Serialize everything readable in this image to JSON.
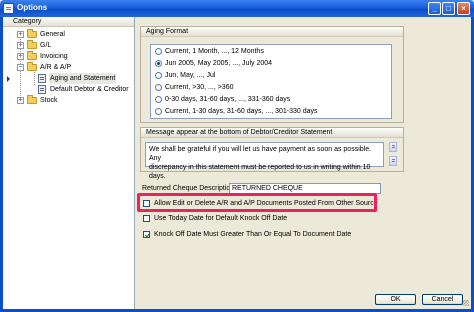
{
  "window": {
    "title": "Options"
  },
  "sidebar": {
    "header": "Category",
    "items": [
      {
        "label": "General",
        "expander": "+"
      },
      {
        "label": "G/L",
        "expander": "+"
      },
      {
        "label": "Invoicing",
        "expander": "+"
      },
      {
        "label": "A/R & A/P",
        "expander": "−"
      },
      {
        "label": "Aging and Statement"
      },
      {
        "label": "Default Debtor & Creditor"
      },
      {
        "label": "Stock",
        "expander": "+"
      }
    ]
  },
  "aging": {
    "title": "Aging Format",
    "options": [
      "Current, 1 Month, ..., 12 Months",
      "Jun 2005, May 2005, ..., July 2004",
      "Jun, May, ..., Jul",
      "Current, >30, ..., >360",
      "0-30 days, 31-60 days, ..., 331-360 days",
      "Current, 1-30 days, 31-60 days, ..., 301-330 days"
    ],
    "selected_index": 1
  },
  "statement": {
    "title": "Message appear at the bottom of Debtor/Creditor Statement",
    "message_line1": "We shall be grateful if you will let us have payment as soon as possible.  Any",
    "message_line2": "discrepancy in this statement must be reported to us in writing within 10 days."
  },
  "returned_cheque": {
    "label": "Returned Cheque Description:",
    "value": "RETURNED CHEQUE"
  },
  "checkboxes": [
    {
      "label": "Allow Edit or Delete A/R and A/P Documents Posted From Other Source",
      "checked": false
    },
    {
      "label": "Use Today Date for Default Knock Off Date",
      "checked": false
    },
    {
      "label": "Knock Off Date Must Greater Than Or Equal To Document Date",
      "checked": true
    }
  ],
  "buttons": {
    "ok": "OK",
    "cancel": "Cancel"
  },
  "colors": {
    "title_bar": "#0b4fc8",
    "highlight": "#e8235f",
    "dialog_bg": "#ece9d8"
  }
}
